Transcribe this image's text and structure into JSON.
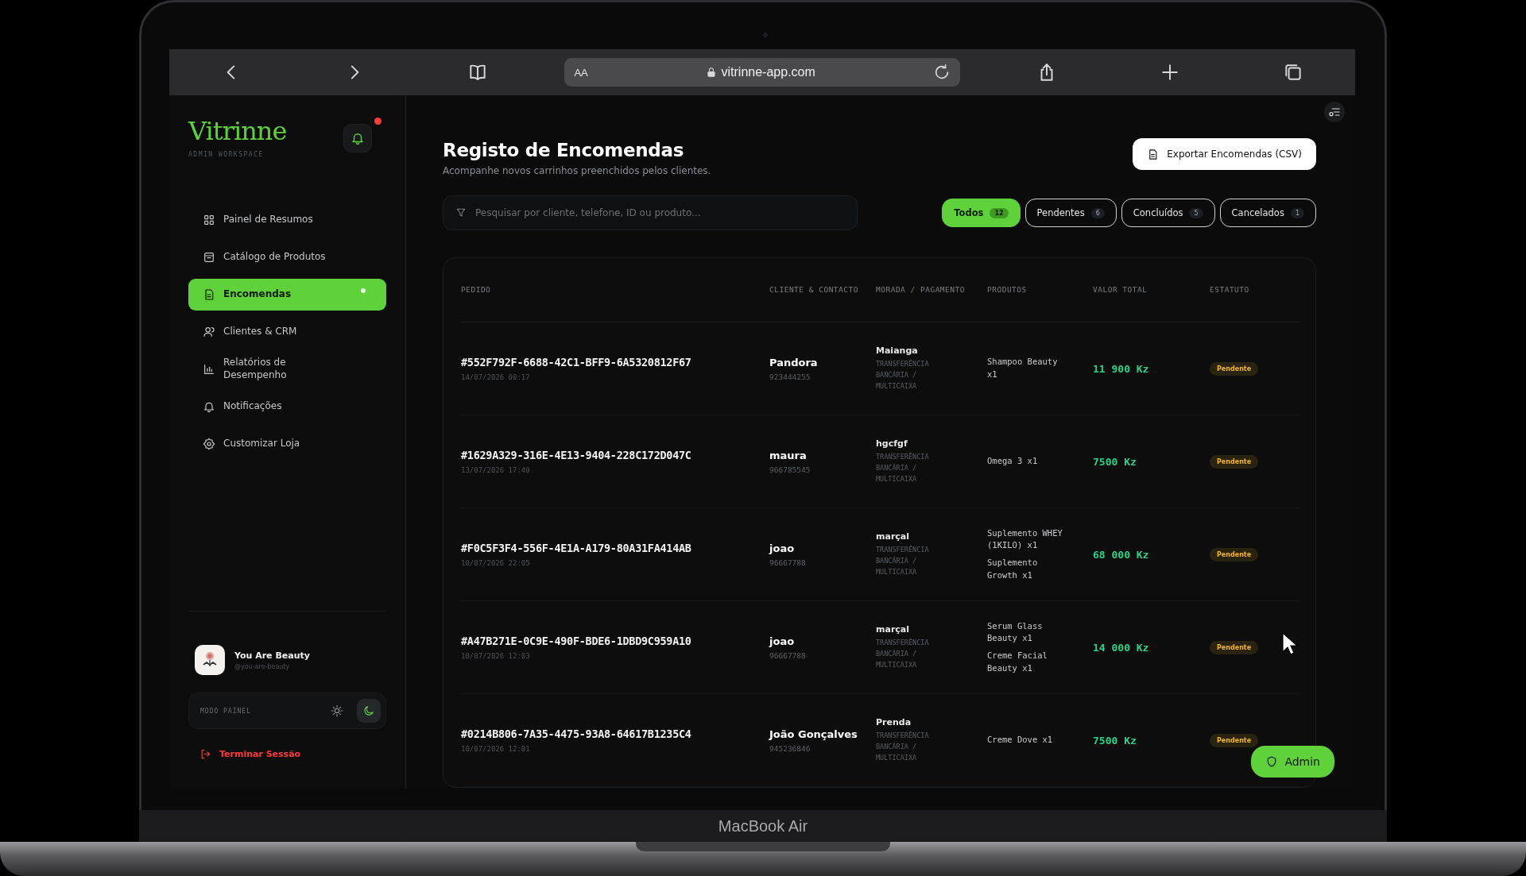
{
  "browser": {
    "reader_label": "AA",
    "url": "vitrinne-app.com"
  },
  "sidebar": {
    "logo": "Vitrinne",
    "workspace": "ADMIN WORKSPACE",
    "notifications": {
      "unread": true
    },
    "nav": [
      {
        "label": "Painel de Resumos",
        "selected": false
      },
      {
        "label": "Catálogo de Produtos",
        "selected": false
      },
      {
        "label": "Encomendas",
        "selected": true
      },
      {
        "label": "Clientes & CRM",
        "selected": false
      },
      {
        "label": "Relatórios de Desempenho",
        "selected": false
      },
      {
        "label": "Notificações",
        "selected": false
      },
      {
        "label": "Customizar Loja",
        "selected": false
      }
    ],
    "store": {
      "name": "You Are Beauty",
      "handle": "@you-are-beauty"
    },
    "theme": {
      "label": "MODO PAINEL",
      "dark_mode": true
    },
    "logout": "Terminar Sessão"
  },
  "page": {
    "title": "Registo de Encomendas",
    "subtitle": "Acompanhe novos carrinhos preenchidos pelos clientes.",
    "export_button": "Exportar Encomendas (CSV)",
    "search": {
      "placeholder": "Pesquisar por cliente, telefone, ID ou produto..."
    },
    "filters": [
      {
        "label": "Todos",
        "count": "12",
        "selected": true
      },
      {
        "label": "Pendentes",
        "count": "6",
        "selected": false
      },
      {
        "label": "Concluídos",
        "count": "5",
        "selected": false
      },
      {
        "label": "Cancelados",
        "count": "1",
        "selected": false
      }
    ]
  },
  "table": {
    "columns": [
      "PEDIDO",
      "CLIENTE & CONTACTO",
      "MORADA / PAGAMENTO",
      "PRODUTOS",
      "VALOR TOTAL",
      "ESTATUTO"
    ],
    "rows": [
      {
        "id": "#552F792F-6688-42C1-BFF9-6A5320812F67",
        "date": "14/07/2026 00:17",
        "client": "Pandora",
        "phone": "923444255",
        "address": "Maianga",
        "payment": "TRANSFERÊNCIA BANCÁRIA / MULTICAIXA",
        "products": [
          "Shampoo Beauty x1"
        ],
        "total": "11 900 Kz",
        "status": "Pendente",
        "kind": "pending"
      },
      {
        "id": "#1629A329-316E-4E13-9404-228C172D047C",
        "date": "13/07/2026 17:40",
        "client": "maura",
        "phone": "966785545",
        "address": "hgcfgf",
        "payment": "TRANSFERÊNCIA BANCÁRIA / MULTICAIXA",
        "products": [
          "Omega 3 x1"
        ],
        "total": "7500 Kz",
        "status": "Pendente",
        "kind": "pending"
      },
      {
        "id": "#F0C5F3F4-556F-4E1A-A179-80A31FA414AB",
        "date": "10/07/2026 22:05",
        "client": "joao",
        "phone": "96667788",
        "address": "marçal",
        "payment": "TRANSFERÊNCIA BANCÁRIA / MULTICAIXA",
        "products": [
          "Suplemento WHEY (1KILO) x1",
          "Suplemento Growth x1"
        ],
        "total": "68 000 Kz",
        "status": "Pendente",
        "kind": "pending"
      },
      {
        "id": "#A47B271E-0C9E-490F-BDE6-1DBD9C959A10",
        "date": "10/07/2026 12:03",
        "client": "joao",
        "phone": "96667788",
        "address": "marçal",
        "payment": "TRANSFERÊNCIA BANCÁRIA / MULTICAIXA",
        "products": [
          "Serum Glass Beauty x1",
          "Creme Facial Beauty x1"
        ],
        "total": "14 000 Kz",
        "status": "Pendente",
        "kind": "pending"
      },
      {
        "id": "#0214B806-7A35-4475-93A8-64617B1235C4",
        "date": "10/07/2026 12:01",
        "client": "João Gonçalves",
        "phone": "945236846",
        "address": "Prenda",
        "payment": "TRANSFERÊNCIA BANCÁRIA / MULTICAIXA",
        "products": [
          "Creme Dove x1"
        ],
        "total": "7500 Kz",
        "status": "Pendente",
        "kind": "pending"
      }
    ]
  },
  "admin_button": "Admin",
  "device_label": "MacBook Air"
}
